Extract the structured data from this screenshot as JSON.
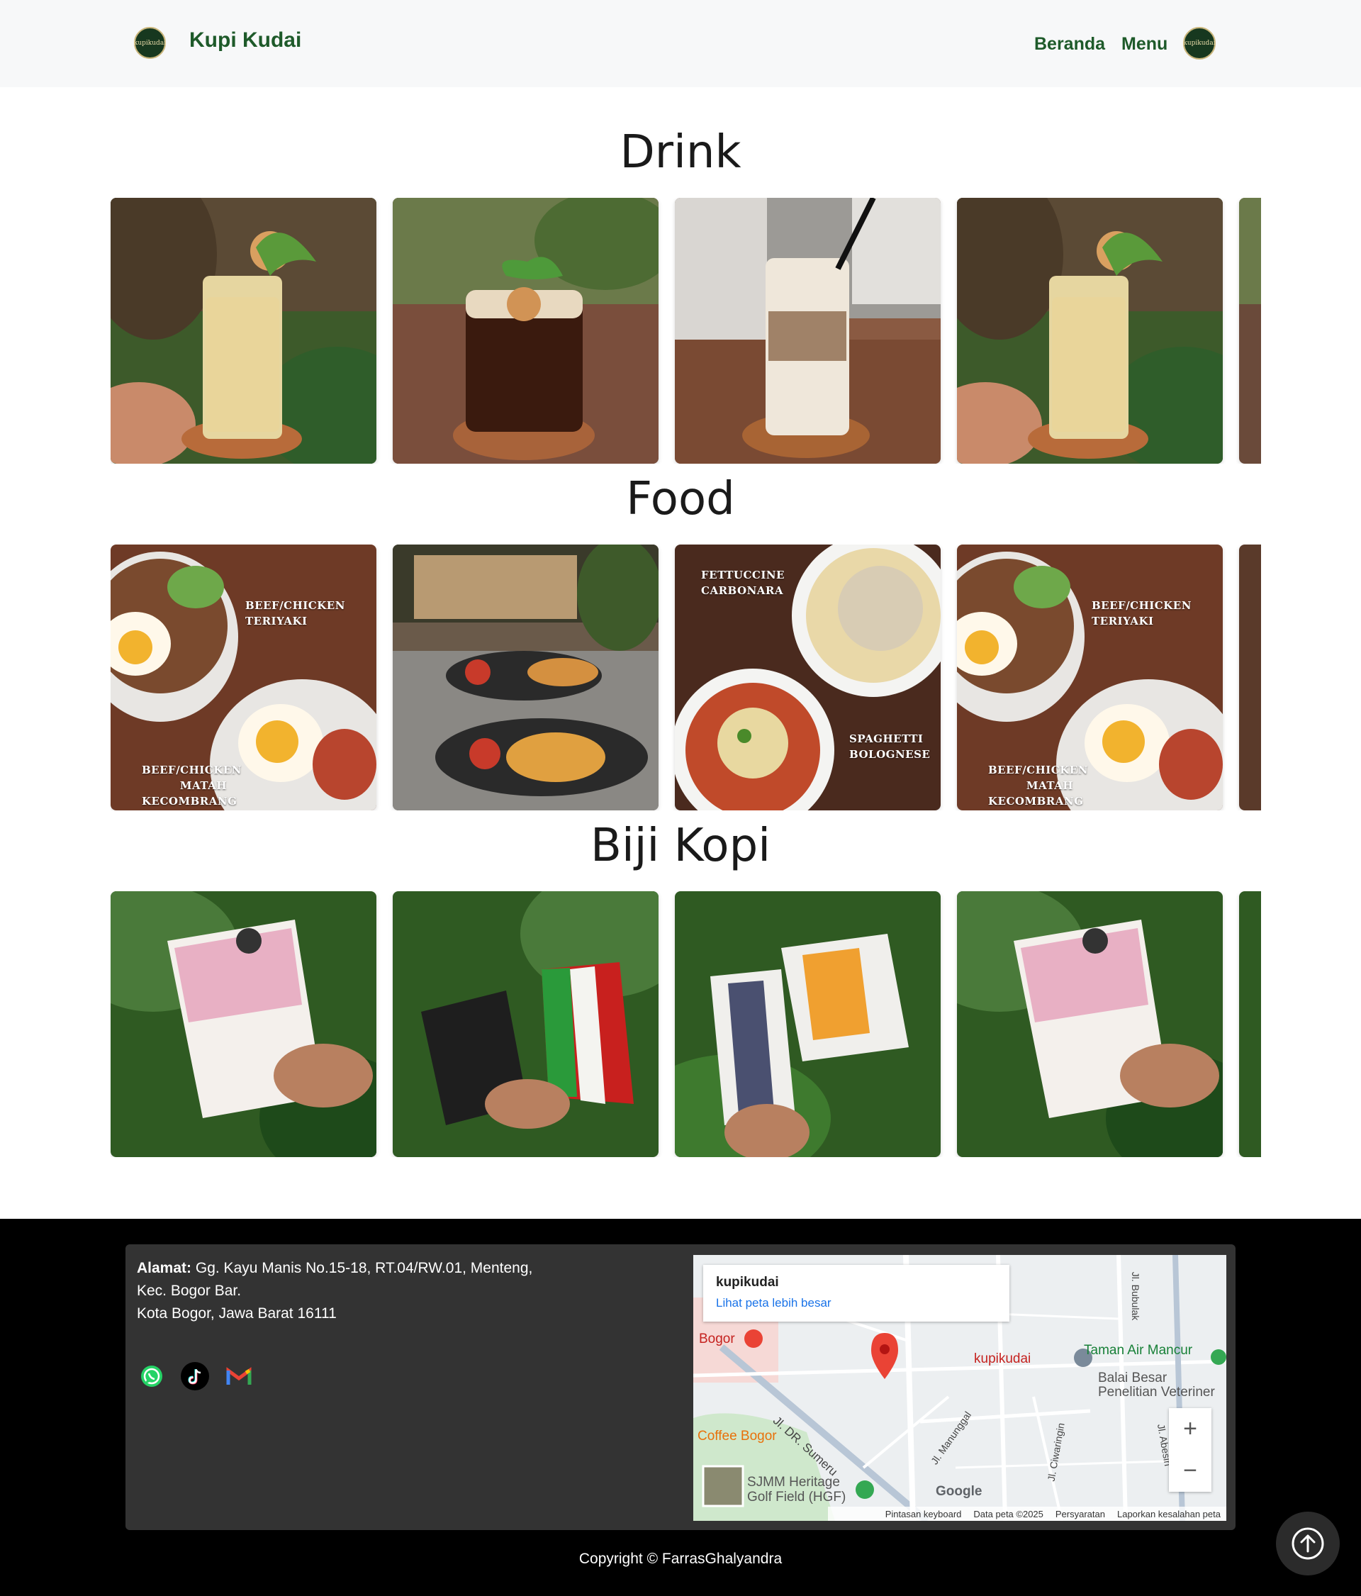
{
  "navbar": {
    "brand": "Kupi Kudai",
    "logo_text": "kupikudai",
    "links": [
      "Beranda",
      "Menu"
    ]
  },
  "sections": {
    "drink": {
      "title": "Drink"
    },
    "food": {
      "title": "Food",
      "labels": {
        "teriyaki": "BEEF/CHICKEN\nTERIYAKI",
        "matah": "BEEF/CHICKEN\nMATAH\nKECOMBRANG",
        "fettuccine": "FETTUCCINE\nCARBONARA",
        "spaghetti": "SPAGHETTI\nBOLOGNESE"
      }
    },
    "beans": {
      "title": "Biji Kopi"
    }
  },
  "footer": {
    "address_label": "Alamat:",
    "address_line1": "Gg. Kayu Manis No.15-18, RT.04/RW.01, Menteng,",
    "address_line2": "Kec. Bogor Bar.",
    "address_line3": "Kota Bogor, Jawa Barat 16111",
    "social_icons": [
      "whatsapp-icon",
      "tiktok-icon",
      "gmail-icon"
    ],
    "map": {
      "place_name": "kupikudai",
      "view_larger": "Lihat peta lebih besar",
      "labels": {
        "bogor": "Bogor",
        "taman": "Taman Air Mancur",
        "balai": "Balai Besar\nPenelitian Veteriner",
        "coffee": "Coffee Bogor",
        "sumeru": "Jl. DR. Sumeru",
        "manunggal": "Jl. Manunggal",
        "ciwaringin": "Jl. Ciwaringin",
        "abesin": "Jl. Abesin",
        "bubulak": "Jl. Bubulak",
        "sjmm": "SJMM Heritage\nGolf Field (HGF)",
        "google": "Google"
      },
      "attribution": [
        "Pintasan keyboard",
        "Data peta ©2025",
        "Persyaratan",
        "Laporkan kesalahan peta"
      ]
    },
    "copyright": "Copyright © FarrasGhalyandra"
  },
  "colors": {
    "brand_green": "#1e5a2a",
    "navbar_bg": "#f7f8f9",
    "footer_bg": "#000000",
    "footer_card": "#333333"
  }
}
